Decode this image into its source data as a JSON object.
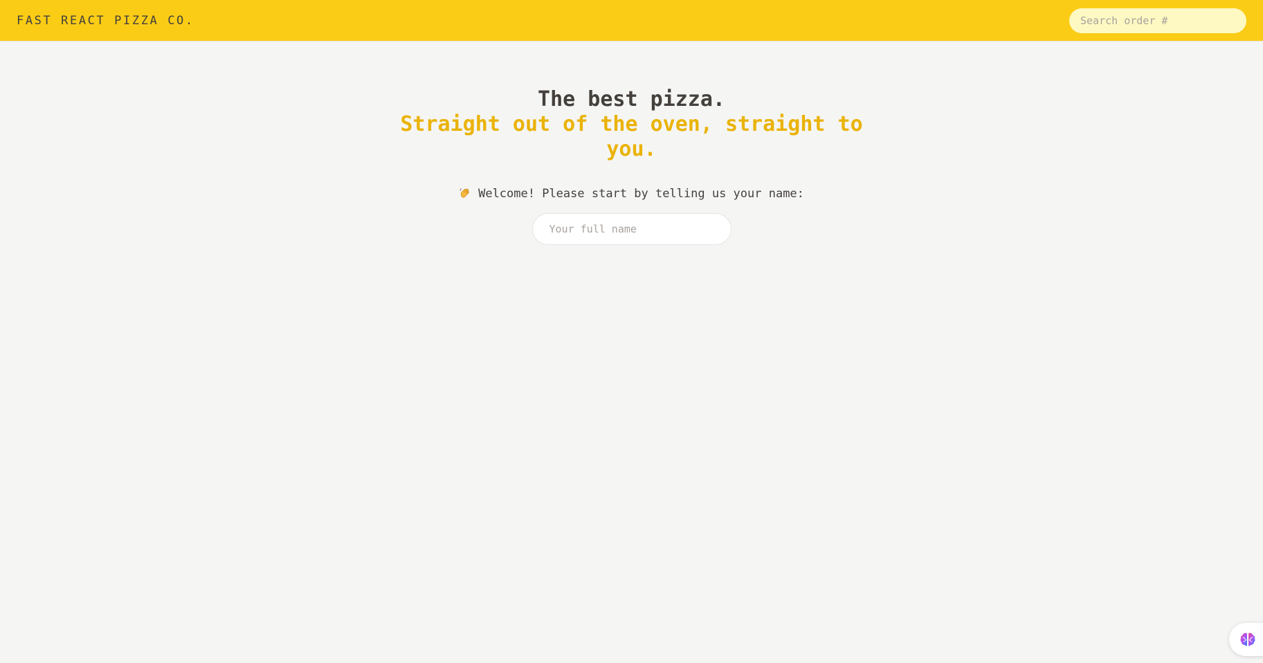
{
  "header": {
    "logo": "FAST REACT PIZZA CO.",
    "search_placeholder": "Search order #"
  },
  "main": {
    "headline": "The best pizza.",
    "headline_accent": "Straight out of the oven, straight to you.",
    "welcome_icon": "waving-hand-icon",
    "welcome_text": "Welcome! Please start by telling us your name:",
    "name_placeholder": "Your full name"
  },
  "widget": {
    "icon": "brain-icon"
  },
  "colors": {
    "header_bg": "#facc15",
    "page_bg": "#f5f5f4",
    "accent": "#eab308",
    "text": "#44403c",
    "search_bg": "#fef9c3"
  }
}
